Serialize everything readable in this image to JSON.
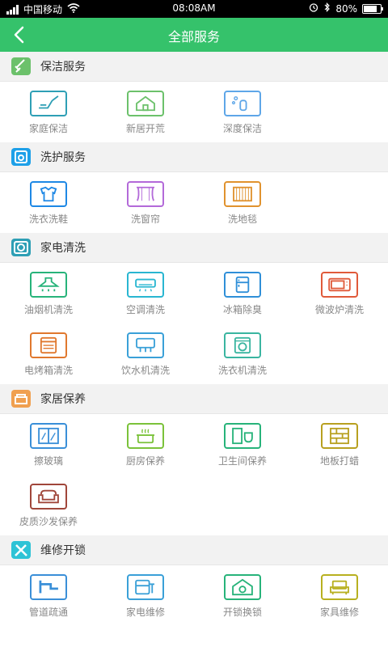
{
  "statusbar": {
    "carrier": "中国移动",
    "time": "08:08AM",
    "battery": "80%"
  },
  "header": {
    "back_icon": "back-arrow-icon",
    "title": "全部服务"
  },
  "colors": {
    "header": "#35c26b",
    "cleaning": "#6cc16b",
    "laundry": "#1ea0e8",
    "appliance": "#2e9fb5",
    "home": "#f0a050",
    "repair": "#2ec3d6"
  },
  "sections": [
    {
      "title": "保洁服务",
      "icon": "broom-icon",
      "items": [
        {
          "label": "家庭保洁",
          "icon": "dustpan-icon",
          "color": "#2e9fb5"
        },
        {
          "label": "新居开荒",
          "icon": "house-icon",
          "color": "#6cc16b"
        },
        {
          "label": "深度保洁",
          "icon": "spray-bottle-icon",
          "color": "#5ea6e8"
        }
      ]
    },
    {
      "title": "洗护服务",
      "icon": "washing-icon",
      "items": [
        {
          "label": "洗衣洗鞋",
          "icon": "shirt-icon",
          "color": "#1e88e5"
        },
        {
          "label": "洗窗帘",
          "icon": "curtain-icon",
          "color": "#b36ad9"
        },
        {
          "label": "洗地毯",
          "icon": "carpet-icon",
          "color": "#e0922e"
        }
      ]
    },
    {
      "title": "家电清洗",
      "icon": "appliance-icon",
      "items": [
        {
          "label": "油烟机清洗",
          "icon": "range-hood-icon",
          "color": "#27b37a"
        },
        {
          "label": "空调清洗",
          "icon": "air-conditioner-icon",
          "color": "#29b6d1"
        },
        {
          "label": "冰箱除臭",
          "icon": "fridge-icon",
          "color": "#2f8fd8"
        },
        {
          "label": "微波炉清洗",
          "icon": "microwave-icon",
          "color": "#e05a3a"
        },
        {
          "label": "电烤箱清洗",
          "icon": "oven-icon",
          "color": "#e0782e"
        },
        {
          "label": "饮水机清洗",
          "icon": "water-dispenser-icon",
          "color": "#3aa0d8"
        },
        {
          "label": "洗衣机清洗",
          "icon": "washing-machine-icon",
          "color": "#3ab5a0"
        }
      ]
    },
    {
      "title": "家居保养",
      "icon": "sofa-icon",
      "items": [
        {
          "label": "擦玻璃",
          "icon": "window-icon",
          "color": "#3a8fd8"
        },
        {
          "label": "厨房保养",
          "icon": "pot-icon",
          "color": "#7bc23a"
        },
        {
          "label": "卫生间保养",
          "icon": "bathroom-icon",
          "color": "#27b37a"
        },
        {
          "label": "地板打蜡",
          "icon": "floor-icon",
          "color": "#b8a020"
        },
        {
          "label": "皮质沙发保养",
          "icon": "leather-sofa-icon",
          "color": "#a0463a"
        }
      ]
    },
    {
      "title": "维修开锁",
      "icon": "tools-icon",
      "items": [
        {
          "label": "管道疏通",
          "icon": "pipe-icon",
          "color": "#3a8fd8"
        },
        {
          "label": "家电维修",
          "icon": "appliance-repair-icon",
          "color": "#3aa0d8"
        },
        {
          "label": "开锁换锁",
          "icon": "lock-house-icon",
          "color": "#27b37a"
        },
        {
          "label": "家具维修",
          "icon": "furniture-icon",
          "color": "#b8b020"
        }
      ]
    }
  ]
}
